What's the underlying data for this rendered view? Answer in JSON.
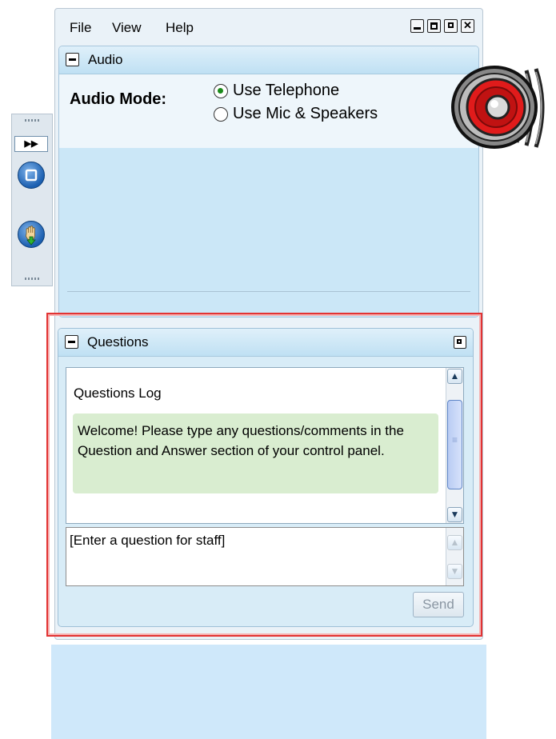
{
  "menu": {
    "file": "File",
    "view": "View",
    "help": "Help"
  },
  "audio": {
    "title": "Audio",
    "mode_label": "Audio Mode:",
    "options": [
      {
        "label": "Use Telephone",
        "selected": true
      },
      {
        "label": "Use Mic & Speakers",
        "selected": false
      }
    ]
  },
  "questions": {
    "title": "Questions",
    "log_title": "Questions Log",
    "welcome_message": "Welcome! Please type any questions/comments in the Question and Answer section of your control panel.",
    "input_value": "[Enter a question for staff]",
    "send_label": "Send"
  },
  "colors": {
    "highlight": "#e23333",
    "panel_bg": "#d8ecf7",
    "message_bg": "#d9edd0",
    "speaker_red": "#e01b1b"
  },
  "icons": [
    "speaker-icon",
    "expand-icon",
    "screen-icon",
    "raise-hand-icon",
    "minimize-icon",
    "maximize-icon",
    "restore-icon",
    "close-icon",
    "collapse-icon",
    "popout-icon"
  ]
}
